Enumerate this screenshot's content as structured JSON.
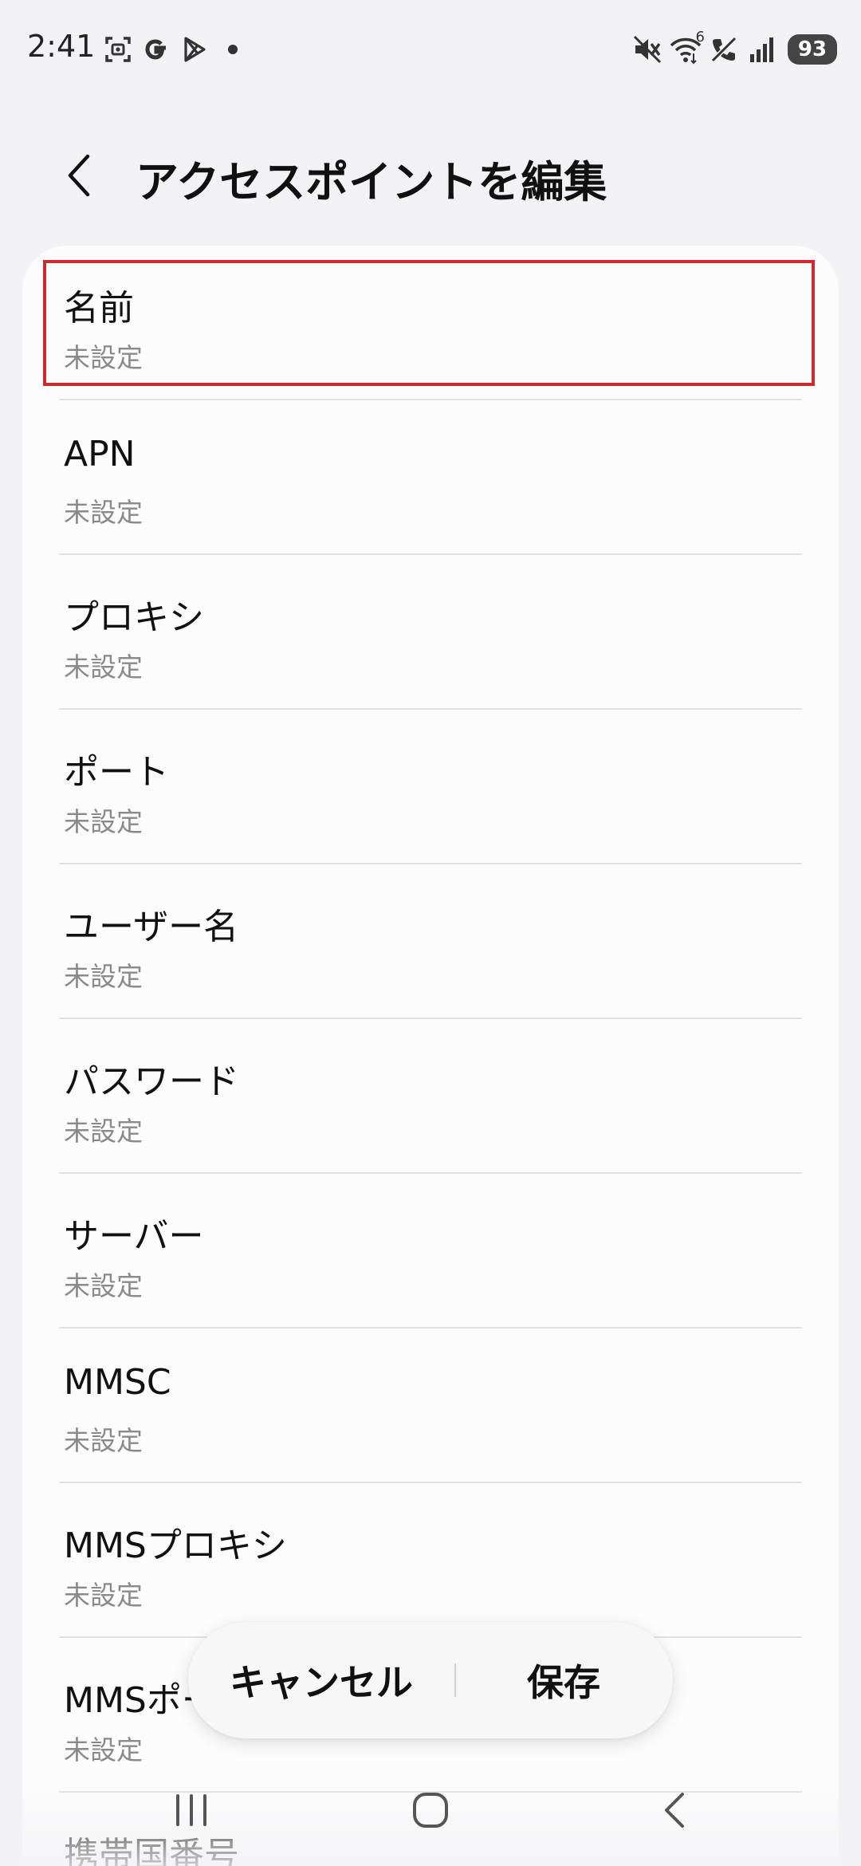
{
  "status_bar": {
    "time": "2:41",
    "left_icons": [
      "screenshot-icon",
      "google-icon",
      "play-store-icon",
      "dot-icon"
    ],
    "right_icons": [
      "mute-icon",
      "wifi-icon",
      "call-off-icon",
      "signal-icon"
    ],
    "wifi_label": "6",
    "battery": "93"
  },
  "header": {
    "title": "アクセスポイントを編集",
    "back_icon": "chevron-left-icon"
  },
  "list": {
    "items": [
      {
        "label": "名前",
        "value": "未設定",
        "selected": true
      },
      {
        "label": "APN",
        "value": "未設定"
      },
      {
        "label": "プロキシ",
        "value": "未設定"
      },
      {
        "label": "ポート",
        "value": "未設定"
      },
      {
        "label": "ユーザー名",
        "value": "未設定"
      },
      {
        "label": "パスワード",
        "value": "未設定"
      },
      {
        "label": "サーバー",
        "value": "未設定"
      },
      {
        "label": "MMSC",
        "value": "未設定"
      },
      {
        "label": "MMSプロキシ",
        "value": "未設定"
      },
      {
        "label": "MMSポート",
        "value": "未設定"
      },
      {
        "label": "携帯国番号",
        "value": ""
      }
    ]
  },
  "actions": {
    "cancel_label": "キャンセル",
    "save_label": "保存"
  },
  "nav_bar": {
    "icons": [
      "recents-icon",
      "home-icon",
      "back-icon"
    ]
  },
  "colors": {
    "background": "#f2f2f4",
    "card": "#fcfcfd",
    "highlight": "#cc2a2f",
    "secondary_text": "#8a8a8a"
  }
}
